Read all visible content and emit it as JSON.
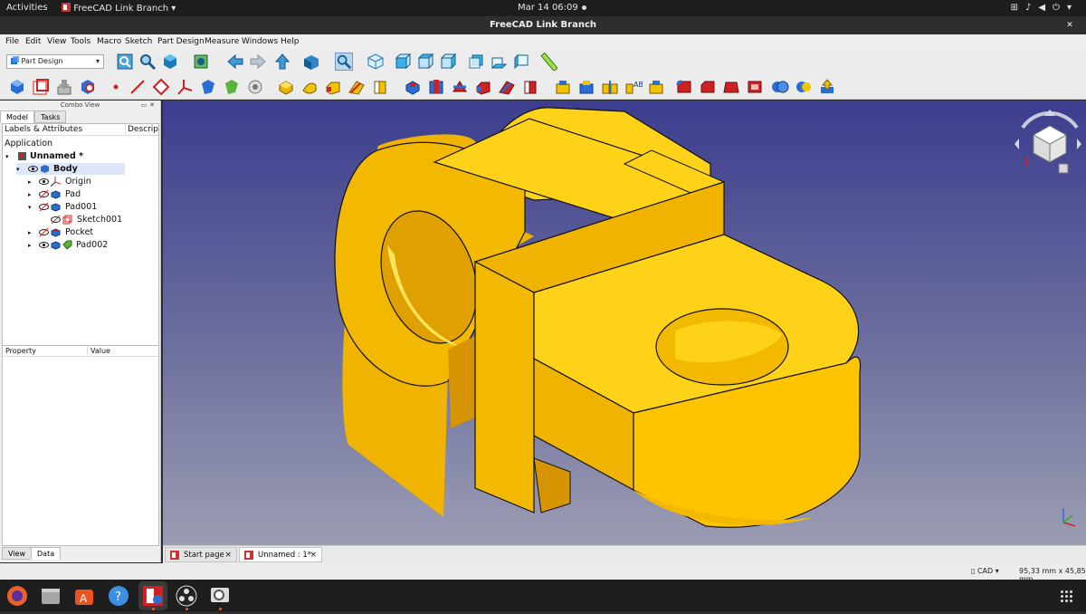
{
  "topbar": {
    "activities": "Activities",
    "app_name": "FreeCAD Link Branch",
    "clock": "Mar 14  06:09"
  },
  "window": {
    "title": "FreeCAD Link Branch"
  },
  "menu": [
    "File",
    "Edit",
    "View",
    "Tools",
    "Macro",
    "Sketch",
    "Part Design",
    "Measure",
    "Windows",
    "Help"
  ],
  "workbench": {
    "selected": "Part Design"
  },
  "combo": {
    "title": "Combo View",
    "tabs": [
      "Model",
      "Tasks"
    ],
    "tree_columns": [
      "Labels & Attributes",
      "Descrip"
    ],
    "root": "Application",
    "items": [
      {
        "label": "Unnamed *",
        "bold": true
      },
      {
        "label": "Body",
        "bold": true
      },
      {
        "label": "Origin"
      },
      {
        "label": "Pad"
      },
      {
        "label": "Pad001"
      },
      {
        "label": "Sketch001"
      },
      {
        "label": "Pocket"
      },
      {
        "label": "Pad002"
      }
    ],
    "property_columns": [
      "Property",
      "Value"
    ],
    "bottom_tabs": [
      "View",
      "Data"
    ]
  },
  "doc_tabs": [
    {
      "label": "Start page",
      "close": "×"
    },
    {
      "label": "Unnamed : 1*",
      "close": "×"
    }
  ],
  "status": {
    "nav_style": "CAD",
    "dimensions": "95,33 mm x 45,85 mm"
  },
  "colors": {
    "model_face": "#ffd21a",
    "model_side": "#f0b400",
    "viewport_top": "#3c3d8f",
    "viewport_bottom": "#9b9db4"
  }
}
